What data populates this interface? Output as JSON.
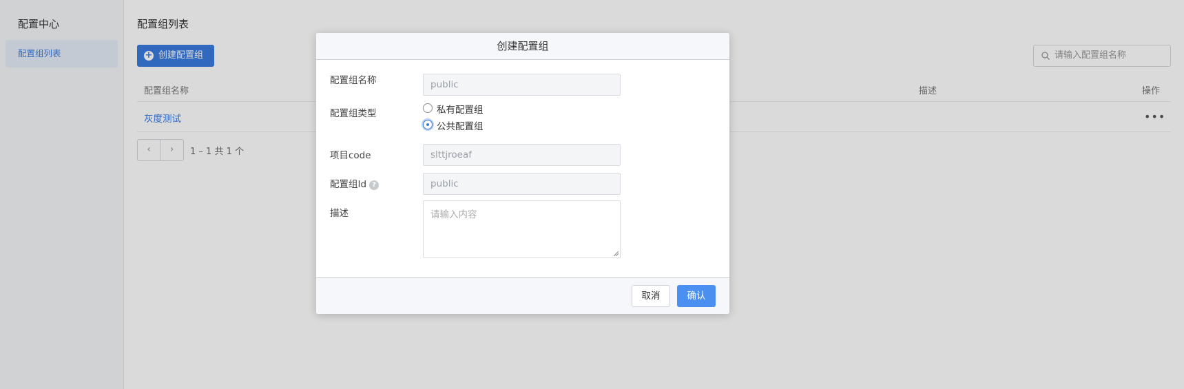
{
  "sidebar": {
    "title": "配置中心",
    "items": [
      {
        "label": "配置组列表"
      }
    ]
  },
  "main": {
    "title": "配置组列表",
    "create_button": "创建配置组",
    "search_placeholder": "请输入配置组名称",
    "table": {
      "columns": [
        "配置组名称",
        "描述",
        "操作"
      ],
      "rows": [
        {
          "name": "灰度测试",
          "description": "",
          "action_icon": "more-icon"
        }
      ]
    },
    "pagination": {
      "prev": "‹",
      "next": "›",
      "summary": "1 – 1 共 1 个"
    }
  },
  "modal": {
    "title": "创建配置组",
    "fields": {
      "name": {
        "label": "配置组名称",
        "value": "public"
      },
      "type": {
        "label": "配置组类型",
        "options": [
          "私有配置组",
          "公共配置组"
        ],
        "selected": "公共配置组"
      },
      "project_code": {
        "label": "项目code",
        "value": "slttjroeaf"
      },
      "group_id": {
        "label": "配置组Id",
        "value": "public",
        "help": "?"
      },
      "description": {
        "label": "描述",
        "placeholder": "请输入内容"
      }
    },
    "buttons": {
      "cancel": "取消",
      "confirm": "确认"
    }
  },
  "colors": {
    "accent": "#3a7be0",
    "confirm_button": "#4b8ff0",
    "sidebar_active_bg": "#e6edf8"
  }
}
